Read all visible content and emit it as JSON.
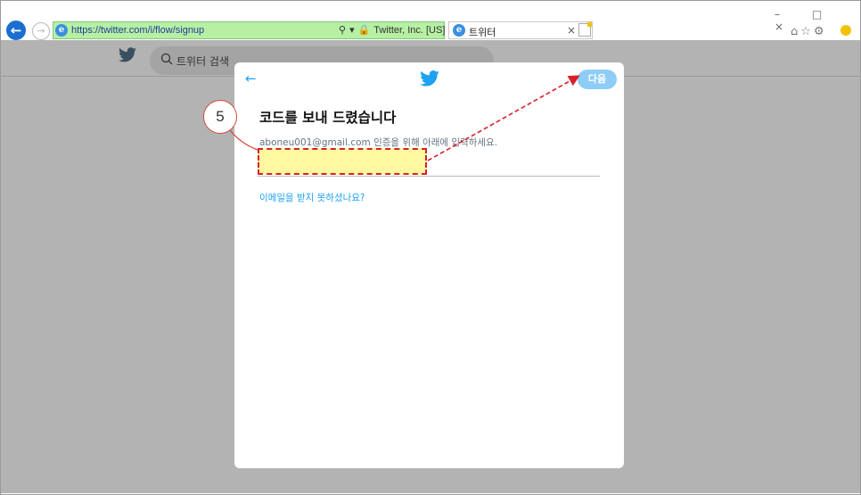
{
  "browser": {
    "url": "https://twitter.com/i/flow/signup",
    "site_identity": "Twitter, Inc. [US]",
    "tab_title": "트위터",
    "tab_close": "×",
    "window_controls": "– □ ×",
    "toolbar_icons": "⌂☆⚙"
  },
  "twitter_header": {
    "search_placeholder": "트위터 검색"
  },
  "modal": {
    "back_arrow": "←",
    "next_label": "다음",
    "title": "코드를 보내 드렸습니다",
    "email": "aboneu001@gmail.com",
    "instruction": "인증을 위해 아래에 입력하세요.",
    "code_value": "",
    "no_email_link": "이메일을 받지 못하셨나요?"
  },
  "annotation": {
    "step_number": "5"
  },
  "colors": {
    "twitter_blue": "#1da1f2",
    "annotation_red": "#d8202a",
    "highlight_yellow": "#fff8a0"
  }
}
